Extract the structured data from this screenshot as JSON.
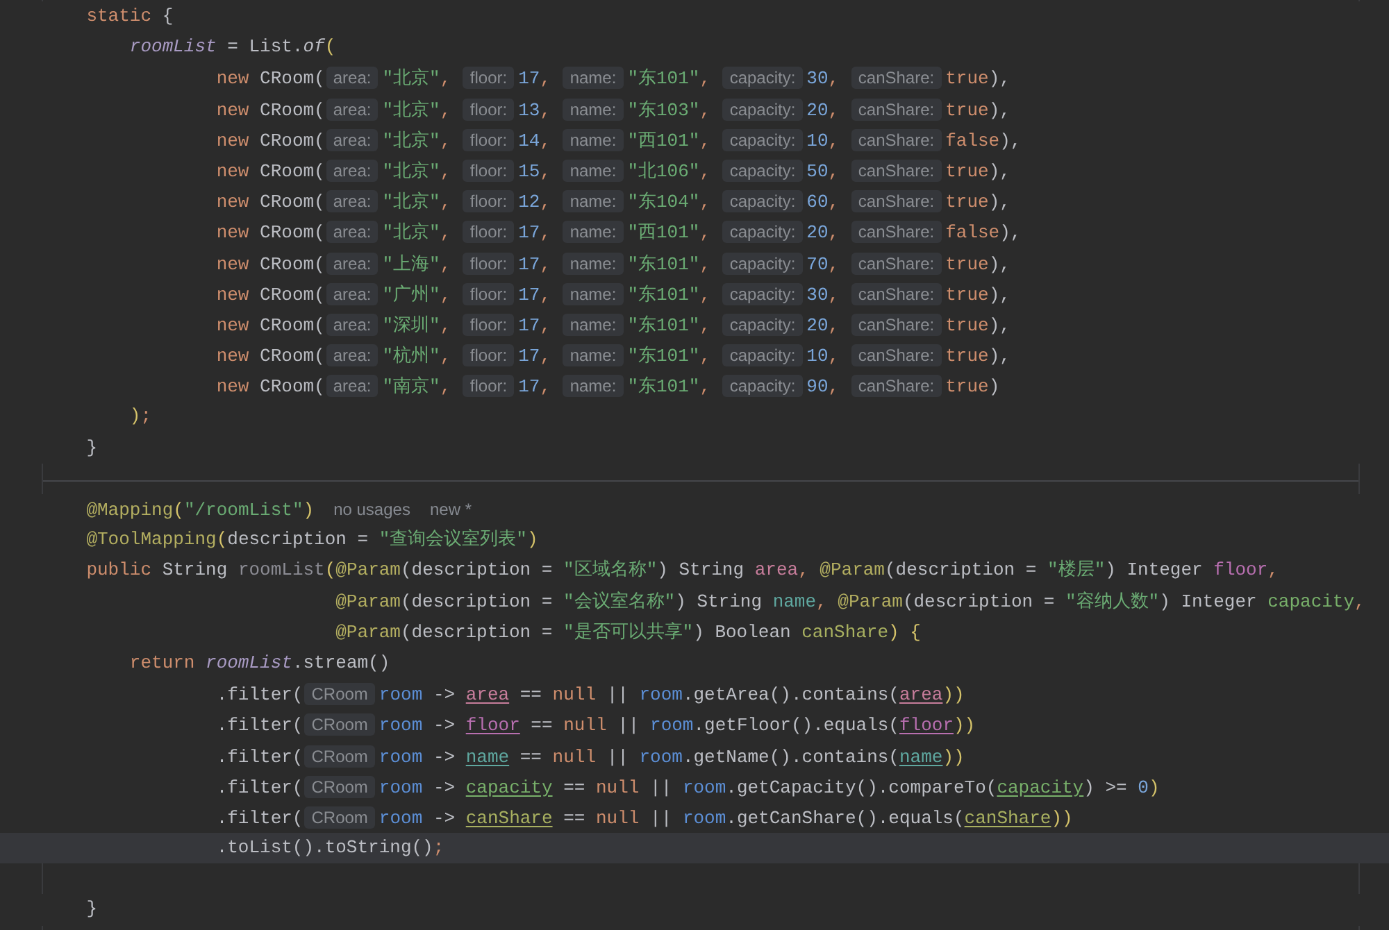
{
  "editor": {
    "lines": [
      {
        "kind": "code",
        "current": false,
        "tokens": [
          {
            "kind": "kw",
            "text": "    static"
          },
          {
            "kind": "plain",
            "text": " {"
          }
        ]
      },
      {
        "kind": "code",
        "current": false,
        "tokens": [
          {
            "kind": "field",
            "text": "        roomList"
          },
          {
            "kind": "plain",
            "text": " = List."
          },
          {
            "kind": "italic",
            "text": "of"
          },
          {
            "kind": "paren",
            "text": "("
          }
        ]
      },
      {
        "kind": "code",
        "current": false,
        "tokens": [
          {
            "kind": "kw",
            "text": "                new"
          },
          {
            "kind": "plain",
            "text": " CRoom("
          },
          {
            "kind": "hint",
            "text": "area:"
          },
          {
            "kind": "str",
            "text": "\"北京\""
          },
          {
            "kind": "kw",
            "text": ", "
          },
          {
            "kind": "hint",
            "text": "floor:"
          },
          {
            "kind": "num",
            "text": "17"
          },
          {
            "kind": "kw",
            "text": ", "
          },
          {
            "kind": "hint",
            "text": "name:"
          },
          {
            "kind": "str",
            "text": "\"东101\""
          },
          {
            "kind": "kw",
            "text": ", "
          },
          {
            "kind": "hint",
            "text": "capacity:"
          },
          {
            "kind": "num",
            "text": "30"
          },
          {
            "kind": "kw",
            "text": ", "
          },
          {
            "kind": "hint",
            "text": "canShare:"
          },
          {
            "kind": "kw",
            "text": "true"
          },
          {
            "kind": "plain",
            "text": "),"
          }
        ]
      },
      {
        "kind": "code",
        "current": false,
        "tokens": [
          {
            "kind": "kw",
            "text": "                new"
          },
          {
            "kind": "plain",
            "text": " CRoom("
          },
          {
            "kind": "hint",
            "text": "area:"
          },
          {
            "kind": "str",
            "text": "\"北京\""
          },
          {
            "kind": "kw",
            "text": ", "
          },
          {
            "kind": "hint",
            "text": "floor:"
          },
          {
            "kind": "num",
            "text": "13"
          },
          {
            "kind": "kw",
            "text": ", "
          },
          {
            "kind": "hint",
            "text": "name:"
          },
          {
            "kind": "str",
            "text": "\"东103\""
          },
          {
            "kind": "kw",
            "text": ", "
          },
          {
            "kind": "hint",
            "text": "capacity:"
          },
          {
            "kind": "num",
            "text": "20"
          },
          {
            "kind": "kw",
            "text": ", "
          },
          {
            "kind": "hint",
            "text": "canShare:"
          },
          {
            "kind": "kw",
            "text": "true"
          },
          {
            "kind": "plain",
            "text": "),"
          }
        ]
      },
      {
        "kind": "code",
        "current": false,
        "tokens": [
          {
            "kind": "kw",
            "text": "                new"
          },
          {
            "kind": "plain",
            "text": " CRoom("
          },
          {
            "kind": "hint",
            "text": "area:"
          },
          {
            "kind": "str",
            "text": "\"北京\""
          },
          {
            "kind": "kw",
            "text": ", "
          },
          {
            "kind": "hint",
            "text": "floor:"
          },
          {
            "kind": "num",
            "text": "14"
          },
          {
            "kind": "kw",
            "text": ", "
          },
          {
            "kind": "hint",
            "text": "name:"
          },
          {
            "kind": "str",
            "text": "\"西101\""
          },
          {
            "kind": "kw",
            "text": ", "
          },
          {
            "kind": "hint",
            "text": "capacity:"
          },
          {
            "kind": "num",
            "text": "10"
          },
          {
            "kind": "kw",
            "text": ", "
          },
          {
            "kind": "hint",
            "text": "canShare:"
          },
          {
            "kind": "kw",
            "text": "false"
          },
          {
            "kind": "plain",
            "text": "),"
          }
        ]
      },
      {
        "kind": "code",
        "current": false,
        "tokens": [
          {
            "kind": "kw",
            "text": "                new"
          },
          {
            "kind": "plain",
            "text": " CRoom("
          },
          {
            "kind": "hint",
            "text": "area:"
          },
          {
            "kind": "str",
            "text": "\"北京\""
          },
          {
            "kind": "kw",
            "text": ", "
          },
          {
            "kind": "hint",
            "text": "floor:"
          },
          {
            "kind": "num",
            "text": "15"
          },
          {
            "kind": "kw",
            "text": ", "
          },
          {
            "kind": "hint",
            "text": "name:"
          },
          {
            "kind": "str",
            "text": "\"北106\""
          },
          {
            "kind": "kw",
            "text": ", "
          },
          {
            "kind": "hint",
            "text": "capacity:"
          },
          {
            "kind": "num",
            "text": "50"
          },
          {
            "kind": "kw",
            "text": ", "
          },
          {
            "kind": "hint",
            "text": "canShare:"
          },
          {
            "kind": "kw",
            "text": "true"
          },
          {
            "kind": "plain",
            "text": "),"
          }
        ]
      },
      {
        "kind": "code",
        "current": false,
        "tokens": [
          {
            "kind": "kw",
            "text": "                new"
          },
          {
            "kind": "plain",
            "text": " CRoom("
          },
          {
            "kind": "hint",
            "text": "area:"
          },
          {
            "kind": "str",
            "text": "\"北京\""
          },
          {
            "kind": "kw",
            "text": ", "
          },
          {
            "kind": "hint",
            "text": "floor:"
          },
          {
            "kind": "num",
            "text": "12"
          },
          {
            "kind": "kw",
            "text": ", "
          },
          {
            "kind": "hint",
            "text": "name:"
          },
          {
            "kind": "str",
            "text": "\"东104\""
          },
          {
            "kind": "kw",
            "text": ", "
          },
          {
            "kind": "hint",
            "text": "capacity:"
          },
          {
            "kind": "num",
            "text": "60"
          },
          {
            "kind": "kw",
            "text": ", "
          },
          {
            "kind": "hint",
            "text": "canShare:"
          },
          {
            "kind": "kw",
            "text": "true"
          },
          {
            "kind": "plain",
            "text": "),"
          }
        ]
      },
      {
        "kind": "code",
        "current": false,
        "tokens": [
          {
            "kind": "kw",
            "text": "                new"
          },
          {
            "kind": "plain",
            "text": " CRoom("
          },
          {
            "kind": "hint",
            "text": "area:"
          },
          {
            "kind": "str",
            "text": "\"北京\""
          },
          {
            "kind": "kw",
            "text": ", "
          },
          {
            "kind": "hint",
            "text": "floor:"
          },
          {
            "kind": "num",
            "text": "17"
          },
          {
            "kind": "kw",
            "text": ", "
          },
          {
            "kind": "hint",
            "text": "name:"
          },
          {
            "kind": "str",
            "text": "\"西101\""
          },
          {
            "kind": "kw",
            "text": ", "
          },
          {
            "kind": "hint",
            "text": "capacity:"
          },
          {
            "kind": "num",
            "text": "20"
          },
          {
            "kind": "kw",
            "text": ", "
          },
          {
            "kind": "hint",
            "text": "canShare:"
          },
          {
            "kind": "kw",
            "text": "false"
          },
          {
            "kind": "plain",
            "text": "),"
          }
        ]
      },
      {
        "kind": "code",
        "current": false,
        "tokens": [
          {
            "kind": "kw",
            "text": "                new"
          },
          {
            "kind": "plain",
            "text": " CRoom("
          },
          {
            "kind": "hint",
            "text": "area:"
          },
          {
            "kind": "str",
            "text": "\"上海\""
          },
          {
            "kind": "kw",
            "text": ", "
          },
          {
            "kind": "hint",
            "text": "floor:"
          },
          {
            "kind": "num",
            "text": "17"
          },
          {
            "kind": "kw",
            "text": ", "
          },
          {
            "kind": "hint",
            "text": "name:"
          },
          {
            "kind": "str",
            "text": "\"东101\""
          },
          {
            "kind": "kw",
            "text": ", "
          },
          {
            "kind": "hint",
            "text": "capacity:"
          },
          {
            "kind": "num",
            "text": "70"
          },
          {
            "kind": "kw",
            "text": ", "
          },
          {
            "kind": "hint",
            "text": "canShare:"
          },
          {
            "kind": "kw",
            "text": "true"
          },
          {
            "kind": "plain",
            "text": "),"
          }
        ]
      },
      {
        "kind": "code",
        "current": false,
        "tokens": [
          {
            "kind": "kw",
            "text": "                new"
          },
          {
            "kind": "plain",
            "text": " CRoom("
          },
          {
            "kind": "hint",
            "text": "area:"
          },
          {
            "kind": "str",
            "text": "\"广州\""
          },
          {
            "kind": "kw",
            "text": ", "
          },
          {
            "kind": "hint",
            "text": "floor:"
          },
          {
            "kind": "num",
            "text": "17"
          },
          {
            "kind": "kw",
            "text": ", "
          },
          {
            "kind": "hint",
            "text": "name:"
          },
          {
            "kind": "str",
            "text": "\"东101\""
          },
          {
            "kind": "kw",
            "text": ", "
          },
          {
            "kind": "hint",
            "text": "capacity:"
          },
          {
            "kind": "num",
            "text": "30"
          },
          {
            "kind": "kw",
            "text": ", "
          },
          {
            "kind": "hint",
            "text": "canShare:"
          },
          {
            "kind": "kw",
            "text": "true"
          },
          {
            "kind": "plain",
            "text": "),"
          }
        ]
      },
      {
        "kind": "code",
        "current": false,
        "tokens": [
          {
            "kind": "kw",
            "text": "                new"
          },
          {
            "kind": "plain",
            "text": " CRoom("
          },
          {
            "kind": "hint",
            "text": "area:"
          },
          {
            "kind": "str",
            "text": "\"深圳\""
          },
          {
            "kind": "kw",
            "text": ", "
          },
          {
            "kind": "hint",
            "text": "floor:"
          },
          {
            "kind": "num",
            "text": "17"
          },
          {
            "kind": "kw",
            "text": ", "
          },
          {
            "kind": "hint",
            "text": "name:"
          },
          {
            "kind": "str",
            "text": "\"东101\""
          },
          {
            "kind": "kw",
            "text": ", "
          },
          {
            "kind": "hint",
            "text": "capacity:"
          },
          {
            "kind": "num",
            "text": "20"
          },
          {
            "kind": "kw",
            "text": ", "
          },
          {
            "kind": "hint",
            "text": "canShare:"
          },
          {
            "kind": "kw",
            "text": "true"
          },
          {
            "kind": "plain",
            "text": "),"
          }
        ]
      },
      {
        "kind": "code",
        "current": false,
        "tokens": [
          {
            "kind": "kw",
            "text": "                new"
          },
          {
            "kind": "plain",
            "text": " CRoom("
          },
          {
            "kind": "hint",
            "text": "area:"
          },
          {
            "kind": "str",
            "text": "\"杭州\""
          },
          {
            "kind": "kw",
            "text": ", "
          },
          {
            "kind": "hint",
            "text": "floor:"
          },
          {
            "kind": "num",
            "text": "17"
          },
          {
            "kind": "kw",
            "text": ", "
          },
          {
            "kind": "hint",
            "text": "name:"
          },
          {
            "kind": "str",
            "text": "\"东101\""
          },
          {
            "kind": "kw",
            "text": ", "
          },
          {
            "kind": "hint",
            "text": "capacity:"
          },
          {
            "kind": "num",
            "text": "10"
          },
          {
            "kind": "kw",
            "text": ", "
          },
          {
            "kind": "hint",
            "text": "canShare:"
          },
          {
            "kind": "kw",
            "text": "true"
          },
          {
            "kind": "plain",
            "text": "),"
          }
        ]
      },
      {
        "kind": "code",
        "current": false,
        "tokens": [
          {
            "kind": "kw",
            "text": "                new"
          },
          {
            "kind": "plain",
            "text": " CRoom("
          },
          {
            "kind": "hint",
            "text": "area:"
          },
          {
            "kind": "str",
            "text": "\"南京\""
          },
          {
            "kind": "kw",
            "text": ", "
          },
          {
            "kind": "hint",
            "text": "floor:"
          },
          {
            "kind": "num",
            "text": "17"
          },
          {
            "kind": "kw",
            "text": ", "
          },
          {
            "kind": "hint",
            "text": "name:"
          },
          {
            "kind": "str",
            "text": "\"东101\""
          },
          {
            "kind": "kw",
            "text": ", "
          },
          {
            "kind": "hint",
            "text": "capacity:"
          },
          {
            "kind": "num",
            "text": "90"
          },
          {
            "kind": "kw",
            "text": ", "
          },
          {
            "kind": "hint",
            "text": "canShare:"
          },
          {
            "kind": "kw",
            "text": "true"
          },
          {
            "kind": "plain",
            "text": ")"
          }
        ]
      },
      {
        "kind": "code",
        "current": false,
        "tokens": [
          {
            "kind": "paren",
            "text": "        )"
          },
          {
            "kind": "kw",
            "text": ";"
          }
        ]
      },
      {
        "kind": "code",
        "current": false,
        "tokens": [
          {
            "kind": "plain",
            "text": "    }"
          }
        ]
      },
      {
        "kind": "blank"
      },
      {
        "kind": "divider"
      },
      {
        "kind": "code",
        "current": false,
        "tokens": [
          {
            "kind": "ann",
            "text": "    @Mapping"
          },
          {
            "kind": "paren",
            "text": "("
          },
          {
            "kind": "str",
            "text": "\"/roomList\""
          },
          {
            "kind": "paren",
            "text": ")"
          },
          {
            "kind": "meta",
            "text": "no usages"
          },
          {
            "kind": "meta",
            "text": "new *"
          }
        ]
      },
      {
        "kind": "code",
        "current": false,
        "tokens": [
          {
            "kind": "ann",
            "text": "    @ToolMapping"
          },
          {
            "kind": "paren",
            "text": "("
          },
          {
            "kind": "plain",
            "text": "description = "
          },
          {
            "kind": "str",
            "text": "\"查询会议室列表\""
          },
          {
            "kind": "paren",
            "text": ")"
          }
        ]
      },
      {
        "kind": "code",
        "current": false,
        "tokens": [
          {
            "kind": "kw",
            "text": "    public"
          },
          {
            "kind": "plain",
            "text": " String "
          },
          {
            "kind": "decl",
            "text": "roomList"
          },
          {
            "kind": "paren",
            "text": "("
          },
          {
            "kind": "ann",
            "text": "@Param"
          },
          {
            "kind": "plain",
            "text": "(description = "
          },
          {
            "kind": "str",
            "text": "\"区域名称\""
          },
          {
            "kind": "plain",
            "text": ") String "
          },
          {
            "kind": "var",
            "color": "#c77d9b",
            "text": "area"
          },
          {
            "kind": "kw",
            "text": ", "
          },
          {
            "kind": "ann",
            "text": "@Param"
          },
          {
            "kind": "plain",
            "text": "(description = "
          },
          {
            "kind": "str",
            "text": "\"楼层\""
          },
          {
            "kind": "plain",
            "text": ") Integer "
          },
          {
            "kind": "var",
            "color": "#b86fb0",
            "text": "floor"
          },
          {
            "kind": "kw",
            "text": ","
          }
        ]
      },
      {
        "kind": "code",
        "current": false,
        "tokens": [
          {
            "kind": "ann",
            "text": "                           @Param"
          },
          {
            "kind": "plain",
            "text": "(description = "
          },
          {
            "kind": "str",
            "text": "\"会议室名称\""
          },
          {
            "kind": "plain",
            "text": ") String "
          },
          {
            "kind": "var",
            "color": "#5fa8a0",
            "text": "name"
          },
          {
            "kind": "kw",
            "text": ", "
          },
          {
            "kind": "ann",
            "text": "@Param"
          },
          {
            "kind": "plain",
            "text": "(description = "
          },
          {
            "kind": "str",
            "text": "\"容纳人数\""
          },
          {
            "kind": "plain",
            "text": ") Integer "
          },
          {
            "kind": "var",
            "color": "#78b06a",
            "text": "capacity"
          },
          {
            "kind": "kw",
            "text": ","
          }
        ]
      },
      {
        "kind": "code",
        "current": false,
        "tokens": [
          {
            "kind": "ann",
            "text": "                           @Param"
          },
          {
            "kind": "plain",
            "text": "(description = "
          },
          {
            "kind": "str",
            "text": "\"是否可以共享\""
          },
          {
            "kind": "plain",
            "text": ") Boolean "
          },
          {
            "kind": "var",
            "color": "#a8b060",
            "text": "canShare"
          },
          {
            "kind": "paren",
            "text": ") {"
          }
        ]
      },
      {
        "kind": "code",
        "current": false,
        "tokens": [
          {
            "kind": "kw",
            "text": "        return"
          },
          {
            "kind": "field",
            "text": " roomList"
          },
          {
            "kind": "plain",
            "text": ".stream()"
          }
        ]
      },
      {
        "kind": "code",
        "current": false,
        "tokens": [
          {
            "kind": "plain",
            "text": "                .filter("
          },
          {
            "kind": "hint",
            "text": "CRoom"
          },
          {
            "kind": "var",
            "color": "#5c8fd6",
            "text": "room"
          },
          {
            "kind": "plain",
            "text": " -> "
          },
          {
            "kind": "ref",
            "color": "#c77d9b",
            "text": "area"
          },
          {
            "kind": "plain",
            "text": " == "
          },
          {
            "kind": "kw",
            "text": "null"
          },
          {
            "kind": "plain",
            "text": " || "
          },
          {
            "kind": "var",
            "color": "#5c8fd6",
            "text": "room"
          },
          {
            "kind": "plain",
            "text": ".getArea().contains("
          },
          {
            "kind": "ref",
            "color": "#c77d9b",
            "text": "area"
          },
          {
            "kind": "paren",
            "text": "))"
          }
        ]
      },
      {
        "kind": "code",
        "current": false,
        "tokens": [
          {
            "kind": "plain",
            "text": "                .filter("
          },
          {
            "kind": "hint",
            "text": "CRoom"
          },
          {
            "kind": "var",
            "color": "#5c8fd6",
            "text": "room"
          },
          {
            "kind": "plain",
            "text": " -> "
          },
          {
            "kind": "ref",
            "color": "#b86fb0",
            "text": "floor"
          },
          {
            "kind": "plain",
            "text": " == "
          },
          {
            "kind": "kw",
            "text": "null"
          },
          {
            "kind": "plain",
            "text": " || "
          },
          {
            "kind": "var",
            "color": "#5c8fd6",
            "text": "room"
          },
          {
            "kind": "plain",
            "text": ".getFloor().equals("
          },
          {
            "kind": "ref",
            "color": "#b86fb0",
            "text": "floor"
          },
          {
            "kind": "paren",
            "text": "))"
          }
        ]
      },
      {
        "kind": "code",
        "current": false,
        "tokens": [
          {
            "kind": "plain",
            "text": "                .filter("
          },
          {
            "kind": "hint",
            "text": "CRoom"
          },
          {
            "kind": "var",
            "color": "#5c8fd6",
            "text": "room"
          },
          {
            "kind": "plain",
            "text": " -> "
          },
          {
            "kind": "ref",
            "color": "#5fa8a0",
            "text": "name"
          },
          {
            "kind": "plain",
            "text": " == "
          },
          {
            "kind": "kw",
            "text": "null"
          },
          {
            "kind": "plain",
            "text": " || "
          },
          {
            "kind": "var",
            "color": "#5c8fd6",
            "text": "room"
          },
          {
            "kind": "plain",
            "text": ".getName().contains("
          },
          {
            "kind": "ref",
            "color": "#5fa8a0",
            "text": "name"
          },
          {
            "kind": "paren",
            "text": "))"
          }
        ]
      },
      {
        "kind": "code",
        "current": false,
        "tokens": [
          {
            "kind": "plain",
            "text": "                .filter("
          },
          {
            "kind": "hint",
            "text": "CRoom"
          },
          {
            "kind": "var",
            "color": "#5c8fd6",
            "text": "room"
          },
          {
            "kind": "plain",
            "text": " -> "
          },
          {
            "kind": "ref",
            "color": "#78b06a",
            "text": "capacity"
          },
          {
            "kind": "plain",
            "text": " == "
          },
          {
            "kind": "kw",
            "text": "null"
          },
          {
            "kind": "plain",
            "text": " || "
          },
          {
            "kind": "var",
            "color": "#5c8fd6",
            "text": "room"
          },
          {
            "kind": "plain",
            "text": ".getCapacity().compareTo("
          },
          {
            "kind": "ref",
            "color": "#78b06a",
            "text": "capacity"
          },
          {
            "kind": "plain",
            "text": ") >= "
          },
          {
            "kind": "num",
            "text": "0"
          },
          {
            "kind": "paren",
            "text": ")"
          }
        ]
      },
      {
        "kind": "code",
        "current": false,
        "tokens": [
          {
            "kind": "plain",
            "text": "                .filter("
          },
          {
            "kind": "hint",
            "text": "CRoom"
          },
          {
            "kind": "var",
            "color": "#5c8fd6",
            "text": "room"
          },
          {
            "kind": "plain",
            "text": " -> "
          },
          {
            "kind": "ref",
            "color": "#a8b060",
            "text": "canShare"
          },
          {
            "kind": "plain",
            "text": " == "
          },
          {
            "kind": "kw",
            "text": "null"
          },
          {
            "kind": "plain",
            "text": " || "
          },
          {
            "kind": "var",
            "color": "#5c8fd6",
            "text": "room"
          },
          {
            "kind": "plain",
            "text": ".getCanShare().equals("
          },
          {
            "kind": "ref",
            "color": "#a8b060",
            "text": "canShare"
          },
          {
            "kind": "paren",
            "text": "))"
          }
        ]
      },
      {
        "kind": "code",
        "current": true,
        "tokens": [
          {
            "kind": "plain",
            "text": "                .toList().toString()"
          },
          {
            "kind": "kw",
            "text": ";"
          }
        ]
      },
      {
        "kind": "blank"
      },
      {
        "kind": "code",
        "current": false,
        "tokens": [
          {
            "kind": "plain",
            "text": "    }"
          }
        ]
      }
    ]
  }
}
